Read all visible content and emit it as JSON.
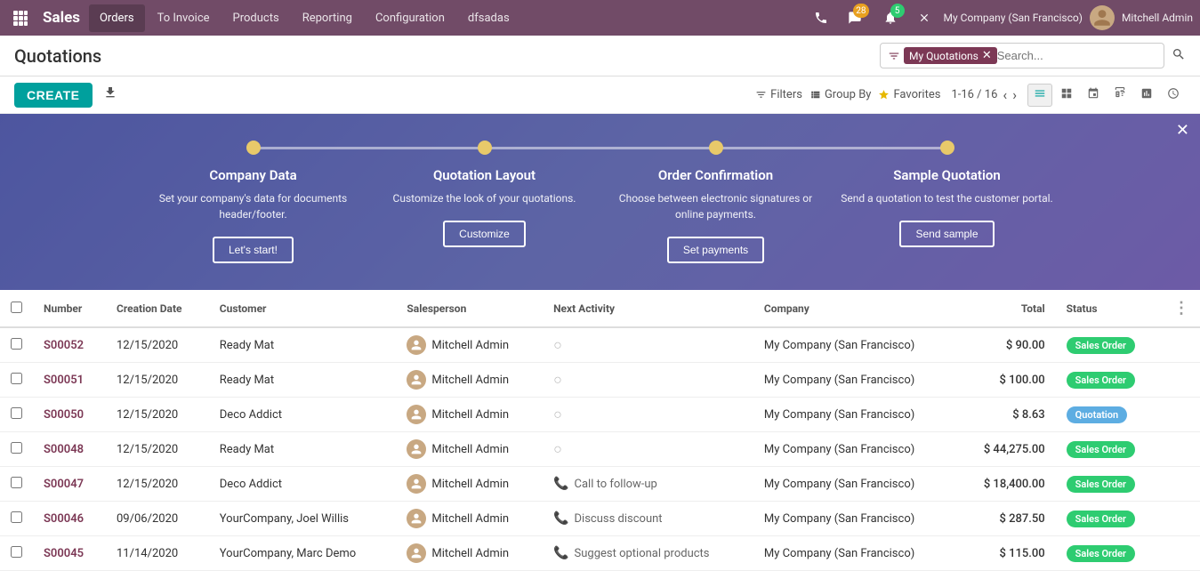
{
  "app": {
    "brand": "Sales",
    "nav_items": [
      {
        "label": "Orders",
        "active": true
      },
      {
        "label": "To Invoice",
        "active": false
      },
      {
        "label": "Products",
        "active": false
      },
      {
        "label": "Reporting",
        "active": false
      },
      {
        "label": "Configuration",
        "active": false
      },
      {
        "label": "dfsadas",
        "active": false
      }
    ],
    "company": "My Company (San Francisco)",
    "username": "Mitchell Admin",
    "badge_phone": "",
    "badge_chat": "28",
    "badge_discuss": "5"
  },
  "page": {
    "title": "Quotations"
  },
  "search": {
    "filter_tag": "My Quotations",
    "placeholder": "Search..."
  },
  "toolbar": {
    "create_label": "CREATE",
    "filters_label": "Filters",
    "groupby_label": "Group By",
    "favorites_label": "Favorites",
    "pager": "1-16 / 16"
  },
  "banner": {
    "steps": [
      {
        "title": "Company Data",
        "desc": "Set your company's data for documents header/footer.",
        "btn": "Let's start!"
      },
      {
        "title": "Quotation Layout",
        "desc": "Customize the look of your quotations.",
        "btn": "Customize"
      },
      {
        "title": "Order Confirmation",
        "desc": "Choose between electronic signatures or online payments.",
        "btn": "Set payments"
      },
      {
        "title": "Sample Quotation",
        "desc": "Send a quotation to test the customer portal.",
        "btn": "Send sample"
      }
    ]
  },
  "table": {
    "columns": [
      "Number",
      "Creation Date",
      "Customer",
      "Salesperson",
      "Next Activity",
      "Company",
      "Total",
      "Status"
    ],
    "rows": [
      {
        "number": "S00052",
        "date": "12/15/2020",
        "customer": "Ready Mat",
        "salesperson": "Mitchell Admin",
        "activity": "",
        "activity_type": "none",
        "company": "My Company (San Francisco)",
        "total": "$ 90.00",
        "status": "Sales Order",
        "status_type": "sales-order"
      },
      {
        "number": "S00051",
        "date": "12/15/2020",
        "customer": "Ready Mat",
        "salesperson": "Mitchell Admin",
        "activity": "",
        "activity_type": "none",
        "company": "My Company (San Francisco)",
        "total": "$ 100.00",
        "status": "Sales Order",
        "status_type": "sales-order"
      },
      {
        "number": "S00050",
        "date": "12/15/2020",
        "customer": "Deco Addict",
        "salesperson": "Mitchell Admin",
        "activity": "",
        "activity_type": "none",
        "company": "My Company (San Francisco)",
        "total": "$ 8.63",
        "status": "Quotation",
        "status_type": "quotation"
      },
      {
        "number": "S00048",
        "date": "12/15/2020",
        "customer": "Ready Mat",
        "salesperson": "Mitchell Admin",
        "activity": "",
        "activity_type": "none",
        "company": "My Company (San Francisco)",
        "total": "$ 44,275.00",
        "status": "Sales Order",
        "status_type": "sales-order"
      },
      {
        "number": "S00047",
        "date": "12/15/2020",
        "customer": "Deco Addict",
        "salesperson": "Mitchell Admin",
        "activity": "Call to follow-up",
        "activity_type": "phone",
        "company": "My Company (San Francisco)",
        "total": "$ 18,400.00",
        "status": "Sales Order",
        "status_type": "sales-order"
      },
      {
        "number": "S00046",
        "date": "09/06/2020",
        "customer": "YourCompany, Joel Willis",
        "salesperson": "Mitchell Admin",
        "activity": "Discuss discount",
        "activity_type": "discuss",
        "company": "My Company (San Francisco)",
        "total": "$ 287.50",
        "status": "Sales Order",
        "status_type": "sales-order"
      },
      {
        "number": "S00045",
        "date": "11/14/2020",
        "customer": "YourCompany, Marc Demo",
        "salesperson": "Mitchell Admin",
        "activity": "Suggest optional products",
        "activity_type": "optional",
        "company": "My Company (San Francisco)",
        "total": "$ 115.00",
        "status": "Sales Order",
        "status_type": "sales-order"
      }
    ]
  }
}
